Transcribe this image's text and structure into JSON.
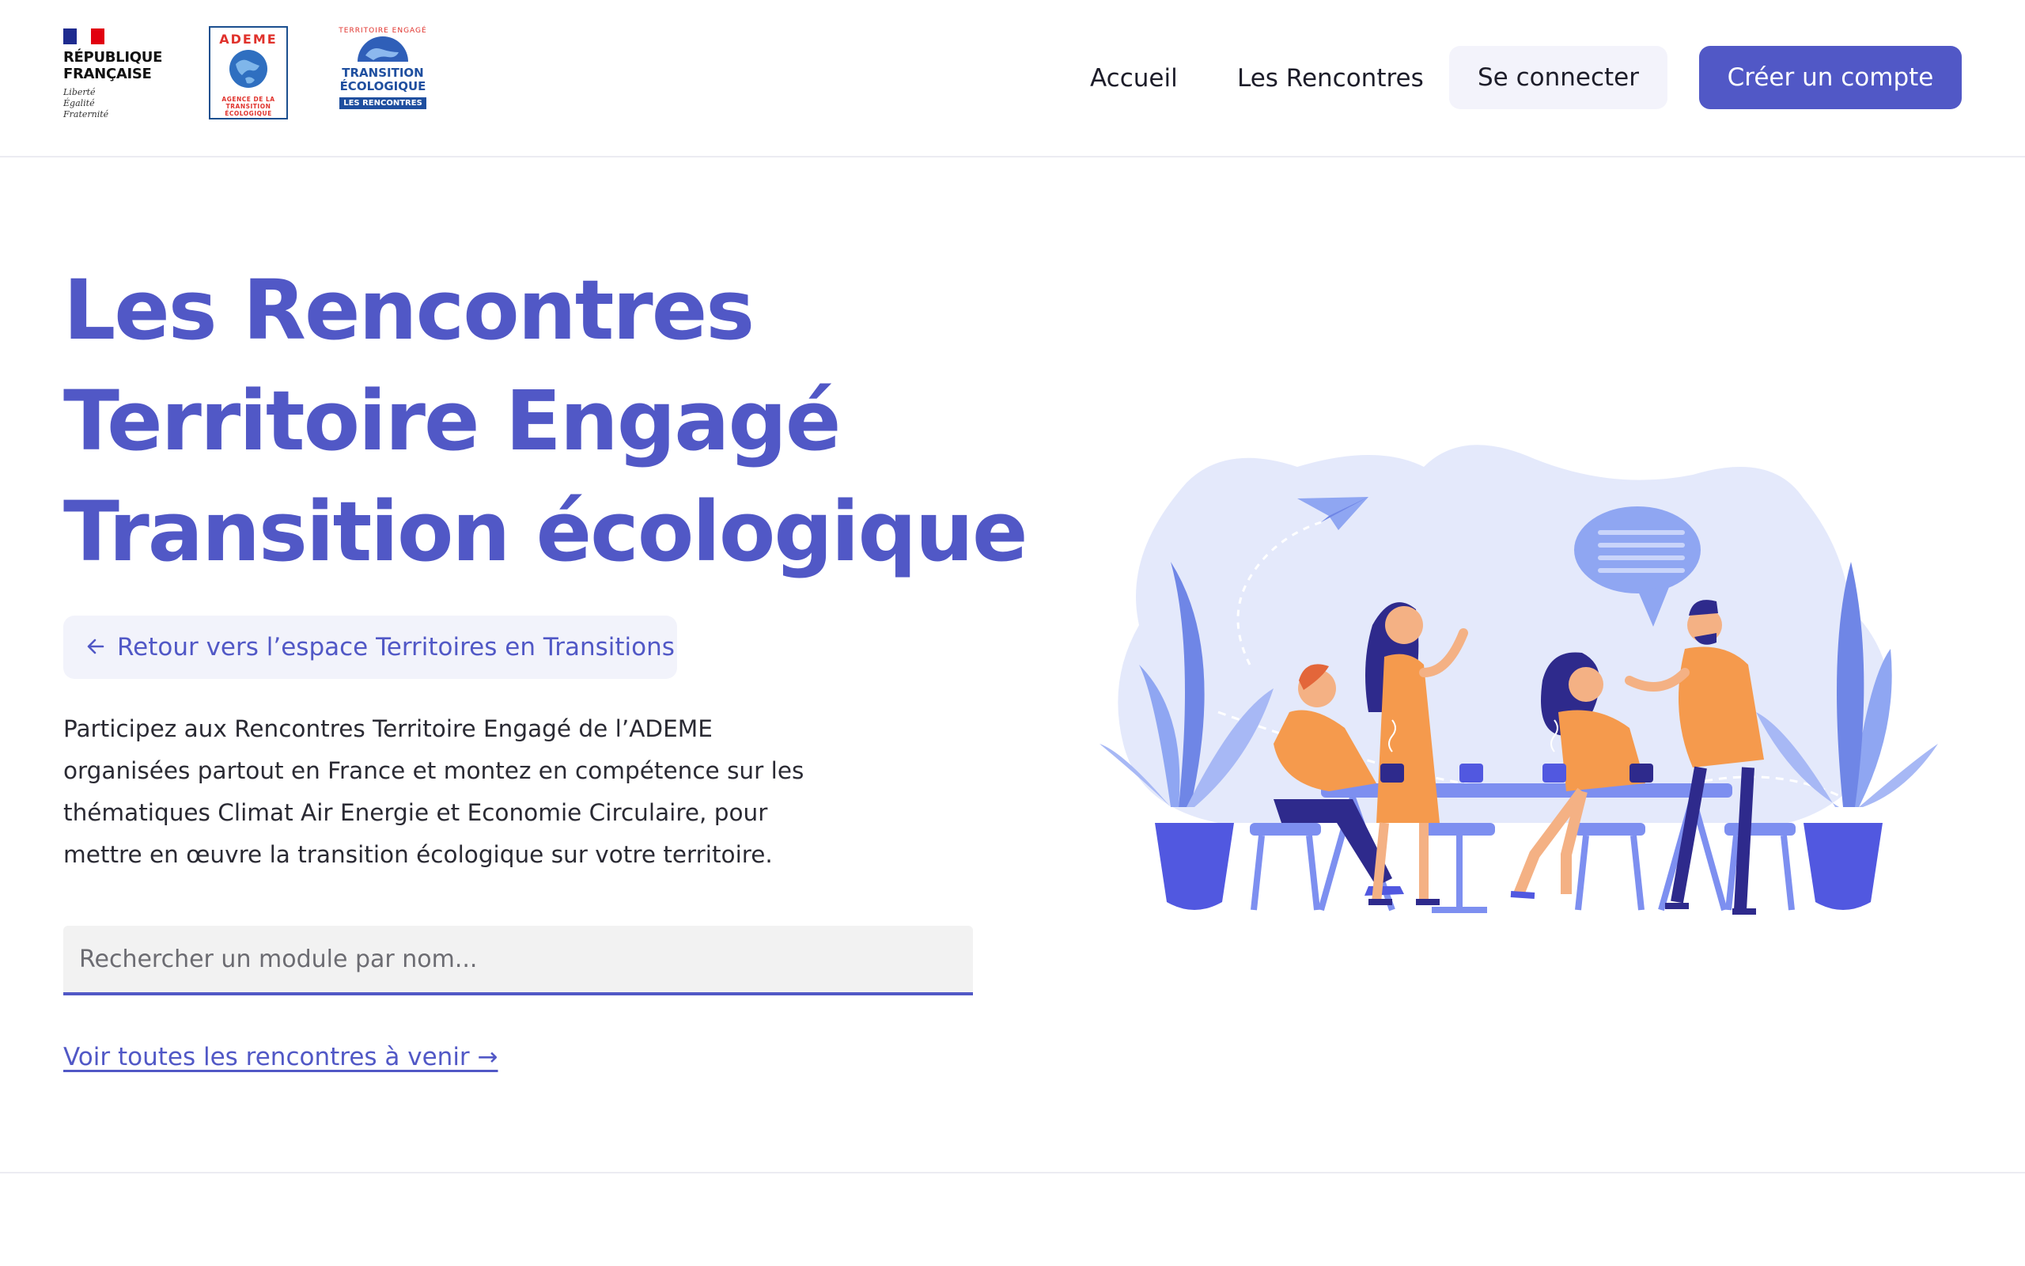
{
  "header": {
    "logos": {
      "republique": {
        "title_line1": "RÉPUBLIQUE",
        "title_line2": "FRANÇAISE",
        "motto1": "Liberté",
        "motto2": "Égalité",
        "motto3": "Fraternité"
      },
      "ademe": {
        "name": "ADEME",
        "subtitle": "AGENCE DE LA\nTRANSITION\nÉCOLOGIQUE"
      },
      "territoire": {
        "ring_text": "TERRITOIRE ENGAGÉ",
        "line1": "TRANSITION",
        "line2": "ÉCOLOGIQUE",
        "badge": "LES RENCONTRES"
      }
    },
    "nav": {
      "home": "Accueil",
      "rencontres": "Les Rencontres",
      "login": "Se connecter",
      "signup": "Créer un compte"
    }
  },
  "hero": {
    "title_line1": "Les Rencontres",
    "title_line2": "Territoire Engagé",
    "title_line3": "Transition écologique",
    "back_label": "Retour vers l’espace Territoires en Transitions",
    "intro": "Participez aux Rencontres Territoire Engagé de l’ADEME organisées partout en France et montez en compétence sur les thématiques Climat Air Energie et Economie Circulaire, pour mettre en œuvre la transition écologique sur votre territoire.",
    "search_placeholder": "Rechercher un module par nom...",
    "all_link": "Voir toutes les rencontres à venir →"
  },
  "colors": {
    "primary": "#5158c6",
    "orange": "#f59a4d",
    "light_blue": "#e3e8fb",
    "mid_blue": "#8fa6f2"
  },
  "icons": {
    "back": "arrow-left-icon"
  }
}
